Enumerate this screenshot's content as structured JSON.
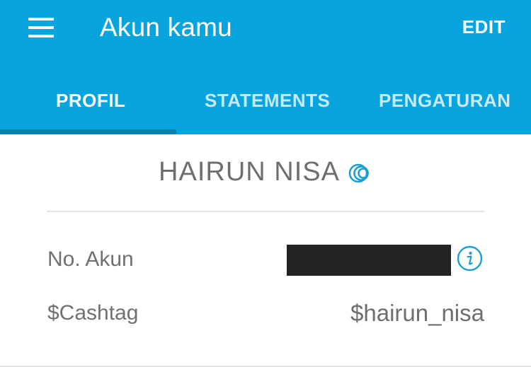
{
  "header": {
    "title": "Akun kamu",
    "edit_label": "EDIT",
    "menu_icon": "hamburger-menu-icon"
  },
  "tabs": [
    {
      "label": "PROFIL",
      "active": true
    },
    {
      "label": "STATEMENTS",
      "active": false
    },
    {
      "label": "PENGATURAN",
      "active": false
    }
  ],
  "profile": {
    "name": "HAIRUN NISA",
    "verified_icon": "verified-rings-icon",
    "fields": {
      "account_number_label": "No. Akun",
      "account_number_value": "",
      "account_info_icon": "info-icon",
      "cashtag_label": "$Cashtag",
      "cashtag_value": "$hairun_nisa"
    }
  },
  "colors": {
    "app_bar": "#08a4dd",
    "tab_indicator": "#0a7fa8",
    "accent_icon": "#1a9fce",
    "text_primary": "#6e6e6e",
    "redaction": "#232323"
  }
}
